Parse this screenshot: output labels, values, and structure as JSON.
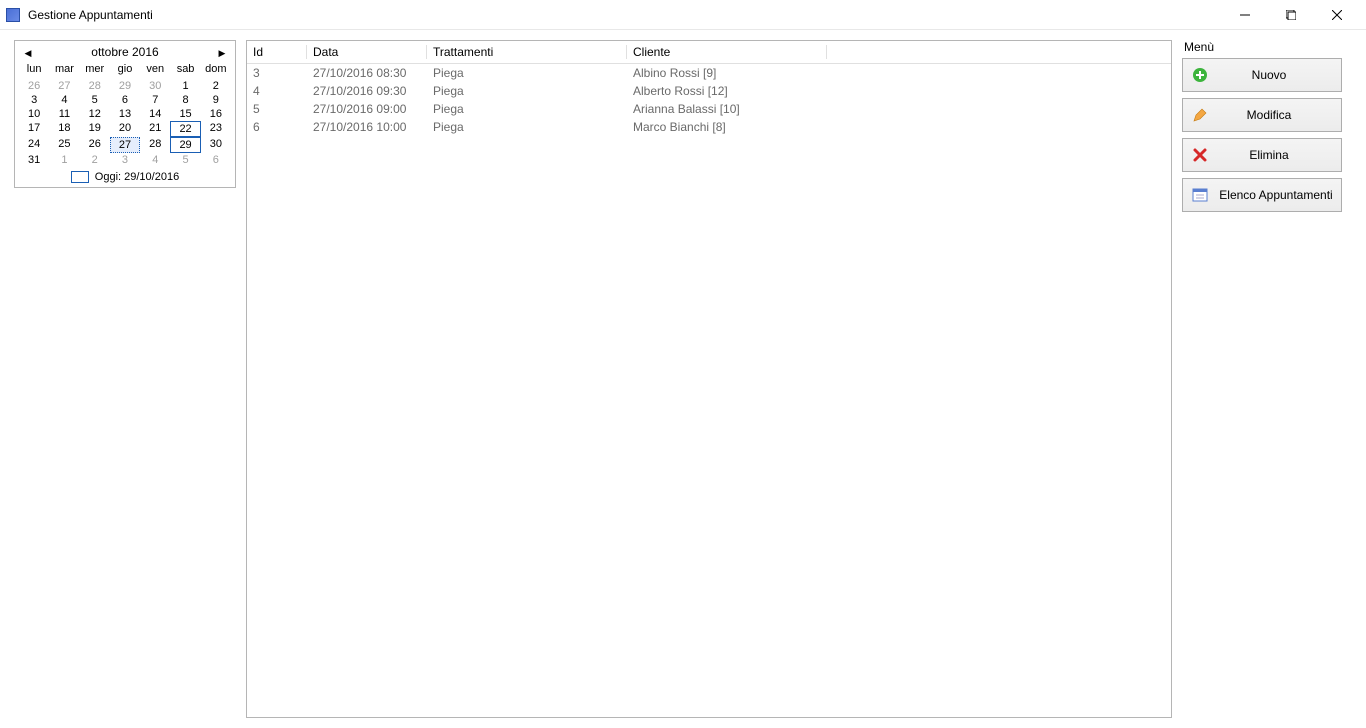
{
  "window": {
    "title": "Gestione Appuntamenti"
  },
  "calendar": {
    "month_label": "ottobre 2016",
    "dow": [
      "lun",
      "mar",
      "mer",
      "gio",
      "ven",
      "sab",
      "dom"
    ],
    "weeks": [
      [
        {
          "d": "26",
          "other": true
        },
        {
          "d": "27",
          "other": true
        },
        {
          "d": "28",
          "other": true
        },
        {
          "d": "29",
          "other": true
        },
        {
          "d": "30",
          "other": true
        },
        {
          "d": "1"
        },
        {
          "d": "2"
        }
      ],
      [
        {
          "d": "3"
        },
        {
          "d": "4"
        },
        {
          "d": "5"
        },
        {
          "d": "6"
        },
        {
          "d": "7"
        },
        {
          "d": "8"
        },
        {
          "d": "9"
        }
      ],
      [
        {
          "d": "10"
        },
        {
          "d": "11"
        },
        {
          "d": "12"
        },
        {
          "d": "13"
        },
        {
          "d": "14"
        },
        {
          "d": "15"
        },
        {
          "d": "16"
        }
      ],
      [
        {
          "d": "17"
        },
        {
          "d": "18"
        },
        {
          "d": "19"
        },
        {
          "d": "20"
        },
        {
          "d": "21"
        },
        {
          "d": "22",
          "today": true
        },
        {
          "d": "23"
        }
      ],
      [
        {
          "d": "24"
        },
        {
          "d": "25"
        },
        {
          "d": "26"
        },
        {
          "d": "27",
          "sel": true
        },
        {
          "d": "28"
        },
        {
          "d": "29",
          "today": true
        },
        {
          "d": "30"
        }
      ],
      [
        {
          "d": "31"
        },
        {
          "d": "1",
          "other": true
        },
        {
          "d": "2",
          "other": true
        },
        {
          "d": "3",
          "other": true
        },
        {
          "d": "4",
          "other": true
        },
        {
          "d": "5",
          "other": true
        },
        {
          "d": "6",
          "other": true
        }
      ]
    ],
    "today_label": "Oggi: 29/10/2016"
  },
  "grid": {
    "columns": [
      "Id",
      "Data",
      "Trattamenti",
      "Cliente"
    ],
    "rows": [
      {
        "id": "3",
        "data": "27/10/2016 08:30",
        "trat": "Piega",
        "cliente": "Albino Rossi [9]"
      },
      {
        "id": "4",
        "data": "27/10/2016 09:30",
        "trat": "Piega",
        "cliente": "Alberto Rossi [12]"
      },
      {
        "id": "5",
        "data": "27/10/2016 09:00",
        "trat": "Piega",
        "cliente": "Arianna Balassi [10]"
      },
      {
        "id": "6",
        "data": "27/10/2016 10:00",
        "trat": "Piega",
        "cliente": "Marco Bianchi [8]"
      }
    ]
  },
  "menu": {
    "title": "Menù",
    "buttons": {
      "nuovo": "Nuovo",
      "modifica": "Modifica",
      "elimina": "Elimina",
      "elenco": "Elenco Appuntamenti"
    }
  }
}
